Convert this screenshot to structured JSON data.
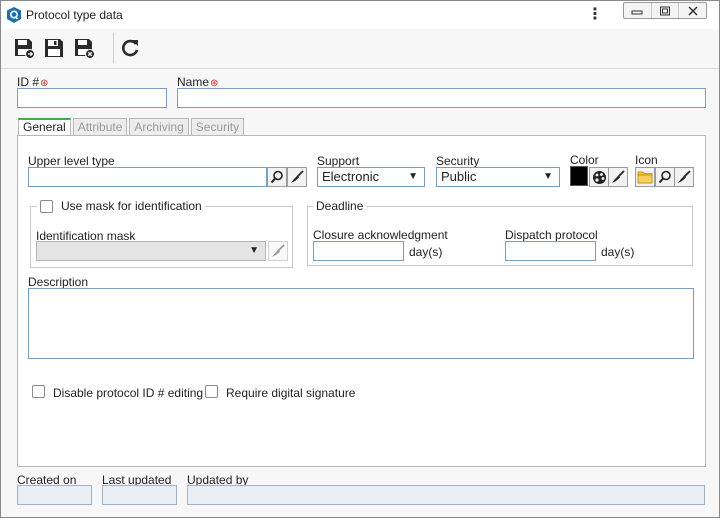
{
  "window": {
    "title": "Protocol type data",
    "menu_glyph": "⋮"
  },
  "fields": {
    "id_label": "ID #",
    "name_label": "Name",
    "required_mark": "⊛"
  },
  "tabs": [
    {
      "label": "General",
      "active": true
    },
    {
      "label": "Attribute",
      "active": false
    },
    {
      "label": "Archiving",
      "active": false
    },
    {
      "label": "Security",
      "active": false
    }
  ],
  "general": {
    "upper_level_type_label": "Upper level type",
    "support_label": "Support",
    "support_value": "Electronic",
    "security_label": "Security",
    "security_value": "Public",
    "color_label": "Color",
    "color_value": "#000000",
    "icon_label": "Icon",
    "use_mask_label": "Use mask for identification",
    "identification_mask_label": "Identification mask",
    "deadline_label": "Deadline",
    "closure_label": "Closure acknowledgment",
    "dispatch_label": "Dispatch protocol",
    "days_unit": "day(s)",
    "description_label": "Description",
    "disable_editing_label": "Disable protocol ID # editing",
    "require_signature_label": "Require digital signature"
  },
  "footer": {
    "created_on_label": "Created on",
    "last_updated_label": "Last updated",
    "updated_by_label": "Updated by"
  },
  "colors": {
    "accent": "#4aa64a",
    "field_border": "#7a9cc4",
    "app_icon": "#1e6fb0",
    "required": "#d21e1e"
  }
}
